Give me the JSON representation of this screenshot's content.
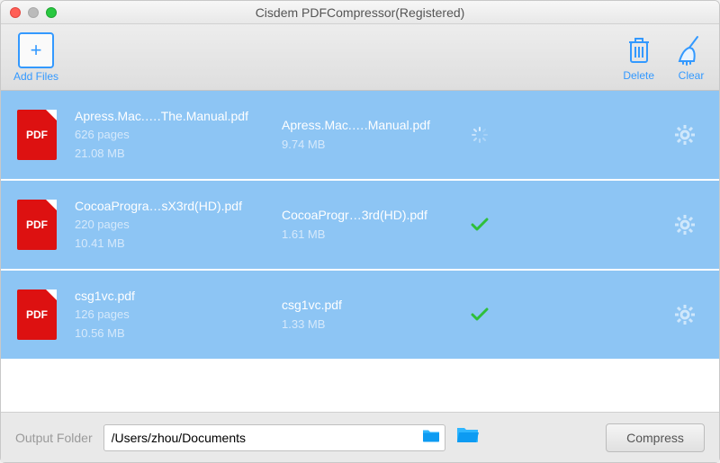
{
  "title": "Cisdem PDFCompressor(Registered)",
  "toolbar": {
    "add_label": "Add Files",
    "delete_label": "Delete",
    "clear_label": "Clear"
  },
  "files": [
    {
      "src_name": "Apress.Mac.….The.Manual.pdf",
      "pages": "626 pages",
      "src_size": "21.08 MB",
      "out_name": "Apress.Mac.….Manual.pdf",
      "out_size": "9.74 MB",
      "status": "loading"
    },
    {
      "src_name": "CocoaProgra…sX3rd(HD).pdf",
      "pages": "220 pages",
      "src_size": "10.41 MB",
      "out_name": "CocoaProgr…3rd(HD).pdf",
      "out_size": "1.61 MB",
      "status": "done"
    },
    {
      "src_name": "csg1vc.pdf",
      "pages": "126 pages",
      "src_size": "10.56 MB",
      "out_name": "csg1vc.pdf",
      "out_size": "1.33 MB",
      "status": "done"
    }
  ],
  "footer": {
    "output_label": "Output Folder",
    "output_path": "/Users/zhou/Documents",
    "compress_label": "Compress"
  },
  "icons": {
    "pdf": "PDF"
  }
}
